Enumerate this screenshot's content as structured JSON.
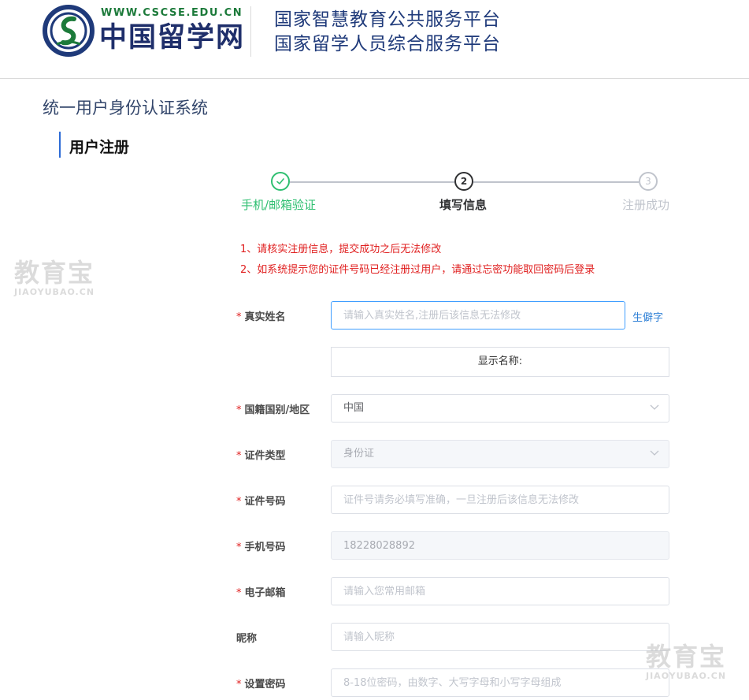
{
  "header": {
    "logo_url": "WWW.CSCSE.EDU.CN",
    "logo_text": "中国留学网",
    "platform_line1": "国家智慧教育公共服务平台",
    "platform_line2": "国家留学人员综合服务平台"
  },
  "page": {
    "system_title": "统一用户身份认证系统",
    "section_title": "用户注册"
  },
  "steps": [
    {
      "label": "手机/邮箱验证",
      "number": "1",
      "status": "done"
    },
    {
      "label": "填写信息",
      "number": "2",
      "status": "active"
    },
    {
      "label": "注册成功",
      "number": "3",
      "status": "todo"
    }
  ],
  "notices": [
    "1、请核实注册信息，提交成功之后无法修改",
    "2、如系统提示您的证件号码已经注册过用户，请通过忘密功能取回密码后登录"
  ],
  "form": {
    "real_name": {
      "label": "真实姓名",
      "required": true,
      "value": "",
      "placeholder": "请输入真实姓名,注册后该信息无法修改"
    },
    "rare_char_link": "生僻字",
    "display_name": "显示名称:",
    "nationality": {
      "label": "国籍国别/地区",
      "required": true,
      "value": "中国"
    },
    "id_type": {
      "label": "证件类型",
      "required": true,
      "value": "身份证"
    },
    "id_number": {
      "label": "证件号码",
      "required": true,
      "value": "",
      "placeholder": "证件号请务必填写准确，一旦注册后该信息无法修改"
    },
    "phone": {
      "label": "手机号码",
      "required": true,
      "value": "18228028892"
    },
    "email": {
      "label": "电子邮箱",
      "required": true,
      "value": "",
      "placeholder": "请输入您常用邮箱"
    },
    "nickname": {
      "label": "昵称",
      "required": false,
      "value": "",
      "placeholder": "请输入昵称"
    },
    "password": {
      "label": "设置密码",
      "required": true,
      "value": "",
      "placeholder": "8-18位密码，由数字、大写字母和小写字母组成"
    }
  },
  "watermarks": {
    "big": "教育宝",
    "small": "JIAOYUBAO.CN"
  },
  "colors": {
    "accent": "#409eff",
    "success": "#2fbf71",
    "required": "#e02020",
    "brand_blue": "#1f3a7a"
  },
  "icons": {
    "step_done": "check-icon",
    "select": "chevron-down-icon"
  }
}
